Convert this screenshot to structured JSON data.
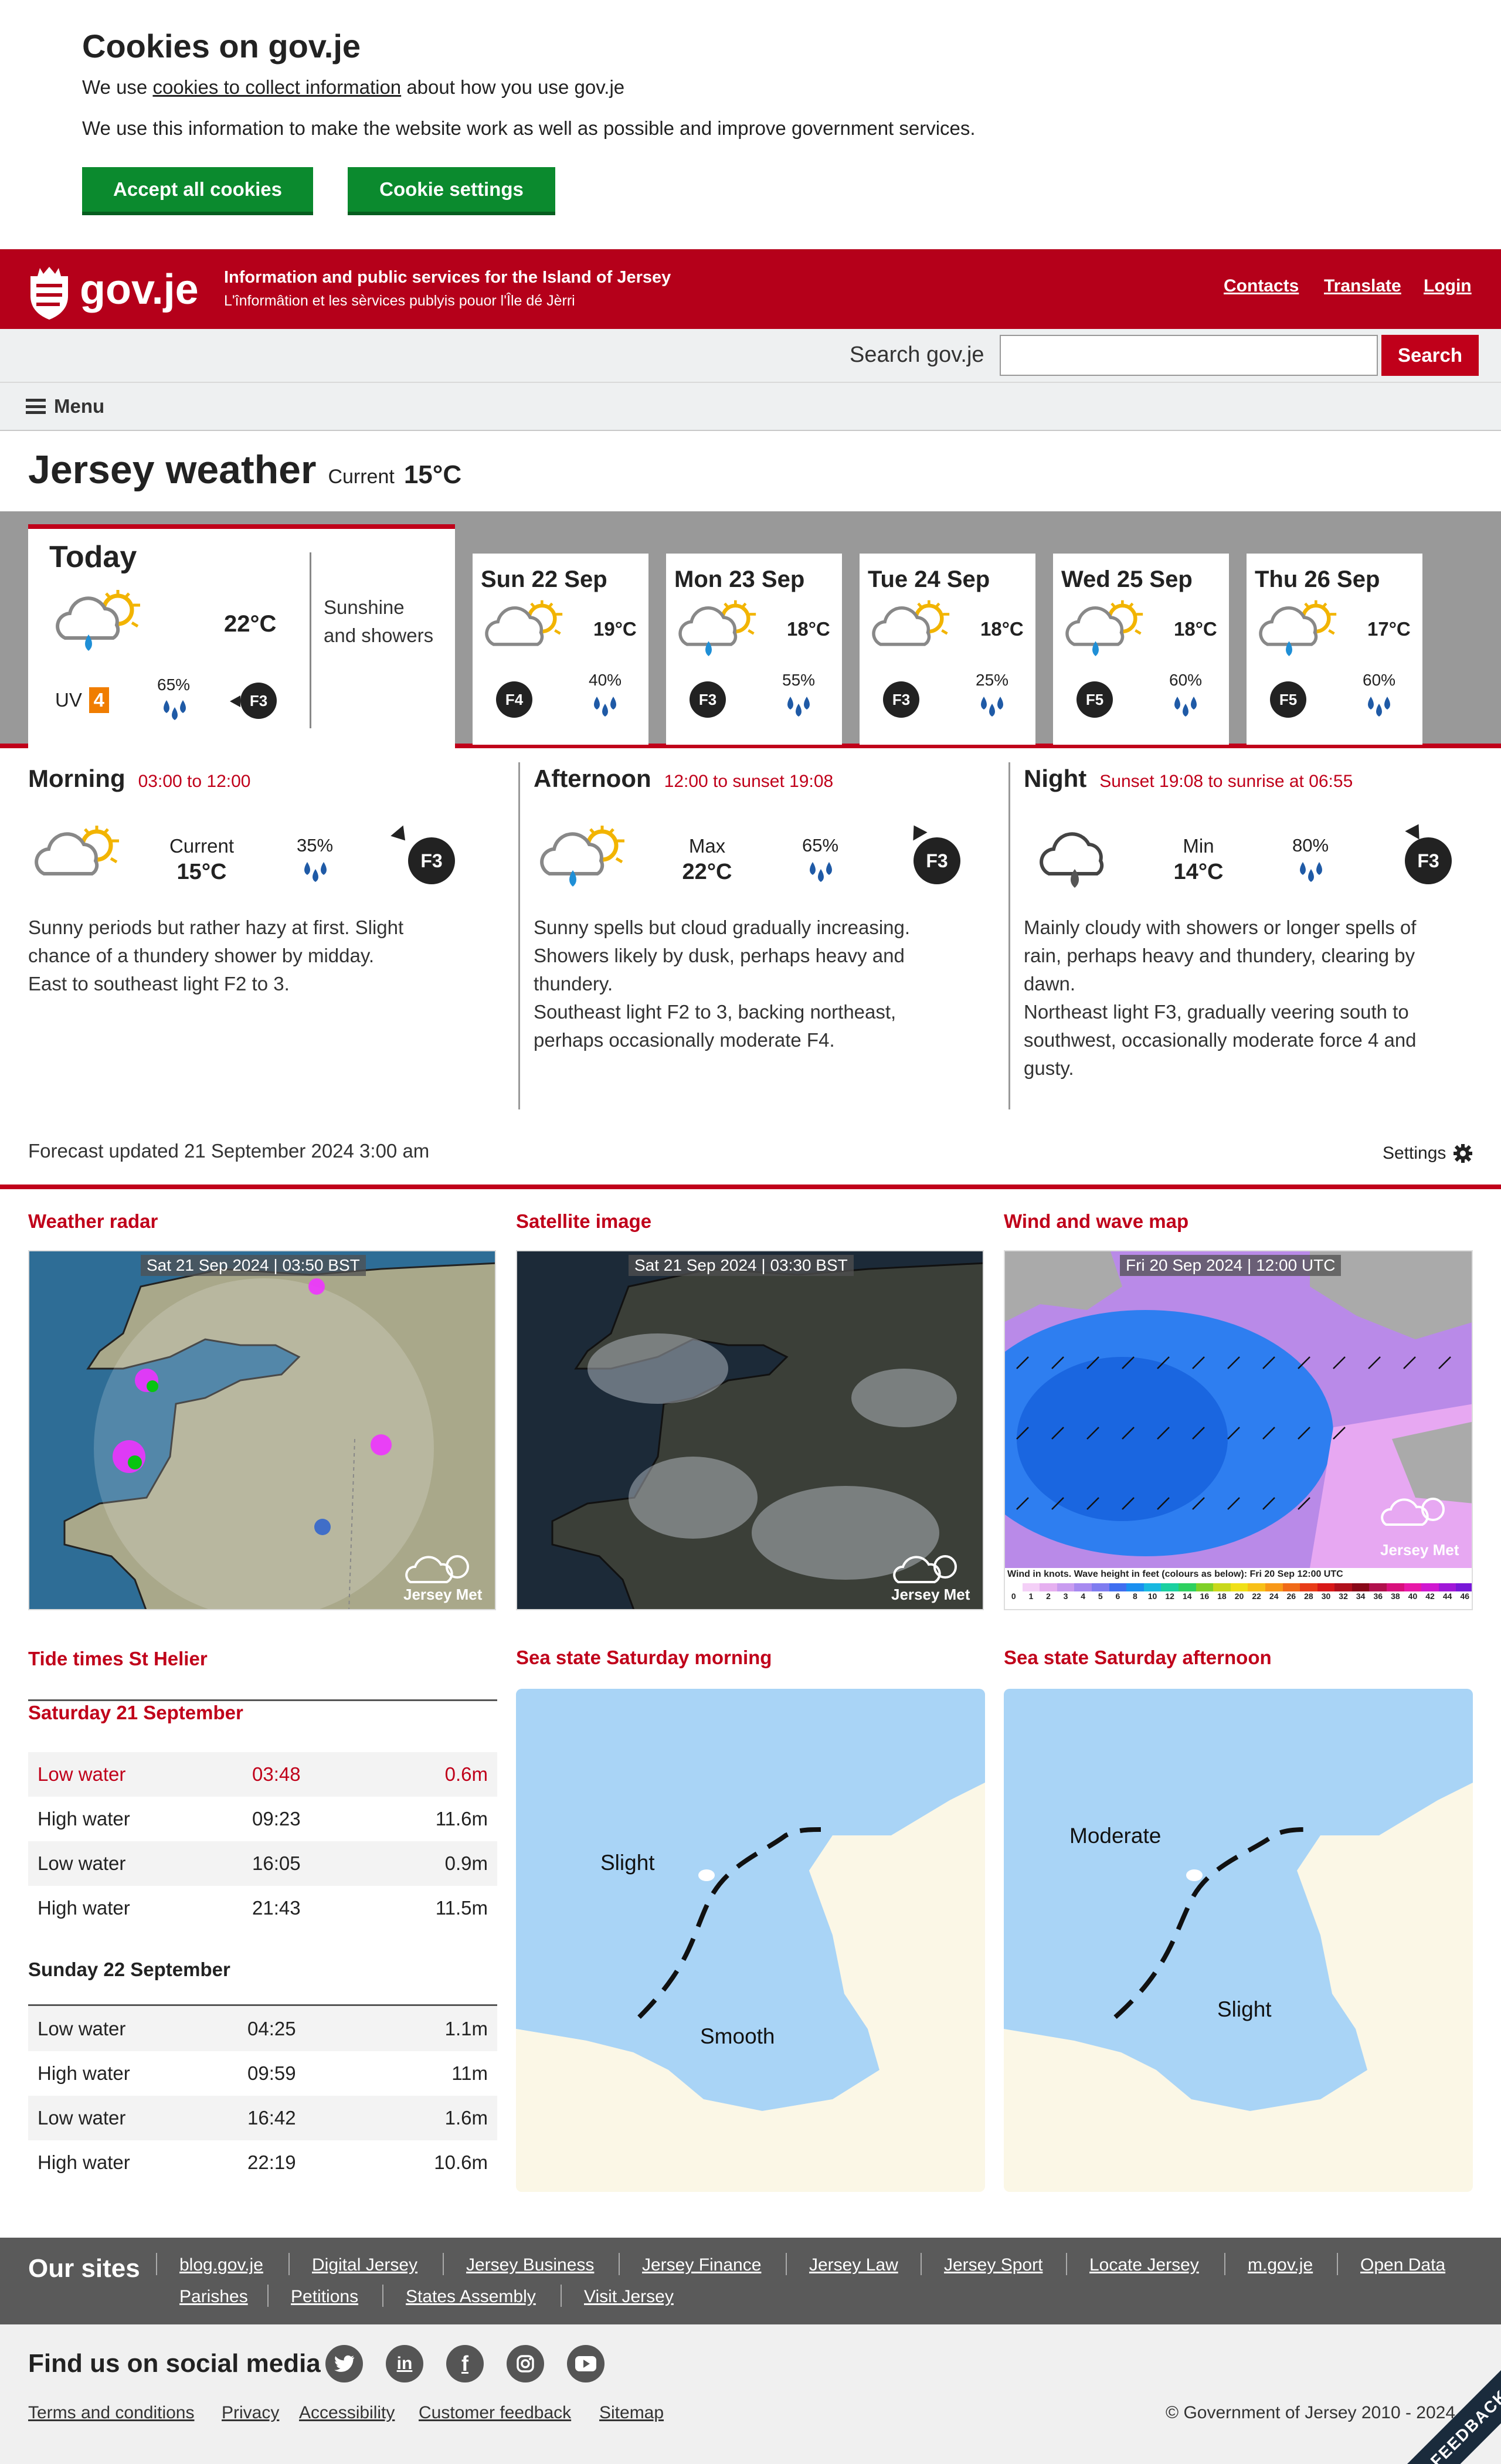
{
  "cookie": {
    "title": "Cookies on gov.je",
    "line1_pre": "We use ",
    "line1_link": "cookies to collect information",
    "line1_post": " about how you use gov.je",
    "line2": "We use this information to make the website work as well as possible and improve government services.",
    "accept_label": "Accept all cookies",
    "settings_label": "Cookie settings"
  },
  "header": {
    "logo_text": "gov.je",
    "tagline_en": "Information and public services for the Island of Jersey",
    "tagline_je": "L'înformâtion et les sèrvices publyis pouor l'Île dé Jèrri",
    "nav": [
      "Contacts",
      "Translate",
      "Login"
    ]
  },
  "search": {
    "label": "Search gov.je",
    "value": "",
    "button": "Search"
  },
  "menu": {
    "label": "Menu"
  },
  "page": {
    "title": "Jersey weather",
    "current_label": "Current",
    "current_temp": "15°C"
  },
  "today": {
    "label": "Today",
    "temp": "22°C",
    "summary_line1": "Sunshine",
    "summary_line2": "and showers",
    "uv_label": "UV",
    "uv_value": "4",
    "rain": "65%",
    "wind": "F3"
  },
  "days": [
    {
      "name": "Sun 22 Sep",
      "temp": "19°C",
      "rain": "40%",
      "wind": "F4"
    },
    {
      "name": "Mon 23 Sep",
      "temp": "18°C",
      "rain": "55%",
      "wind": "F3"
    },
    {
      "name": "Tue 24 Sep",
      "temp": "18°C",
      "rain": "25%",
      "wind": "F3"
    },
    {
      "name": "Wed 25 Sep",
      "temp": "18°C",
      "rain": "60%",
      "wind": "F5"
    },
    {
      "name": "Thu 26 Sep",
      "temp": "17°C",
      "rain": "60%",
      "wind": "F5"
    }
  ],
  "periods": [
    {
      "title": "Morning",
      "time": "03:00 to 12:00",
      "temp_label": "Current",
      "temp": "15°C",
      "rain": "35%",
      "wind": "F3",
      "desc": [
        "Sunny periods but rather hazy at first. Slight",
        "chance of a thundery shower by midday.",
        "East to southeast light F2 to 3."
      ]
    },
    {
      "title": "Afternoon",
      "time": "12:00 to sunset 19:08",
      "temp_label": "Max",
      "temp": "22°C",
      "rain": "65%",
      "wind": "F3",
      "desc": [
        "Sunny spells but cloud gradually increasing.",
        "Showers likely by dusk, perhaps heavy and",
        "thundery.",
        "Southeast light F2 to 3, backing northeast,",
        "perhaps occasionally moderate F4."
      ]
    },
    {
      "title": "Night",
      "time": "Sunset 19:08 to sunrise at 06:55",
      "temp_label": "Min",
      "temp": "14°C",
      "rain": "80%",
      "wind": "F3",
      "desc": [
        "Mainly cloudy with showers or longer spells of",
        "rain, perhaps heavy and thundery, clearing by",
        "dawn.",
        "Northeast light F3, gradually veering south to",
        "southwest, occasionally moderate force 4 and",
        "gusty."
      ]
    }
  ],
  "forecast_updated": "Forecast updated 21 September 2024 3:00 am",
  "settings_label": "Settings",
  "maps": {
    "radar": {
      "title": "Weather radar",
      "stamp": "Sat 21 Sep 2024 | 03:50 BST",
      "brand": "Jersey Met"
    },
    "satellite": {
      "title": "Satellite image",
      "stamp": "Sat 21 Sep 2024 | 03:30 BST",
      "brand": "Jersey Met"
    },
    "wind": {
      "title": "Wind and wave map",
      "stamp": "Fri 20 Sep 2024 | 12:00 UTC",
      "brand": "Jersey Met",
      "legend": "Wind in knots. Wave height in feet (colours as below): Fri 20 Sep 12:00 UTC",
      "scale": [
        "0",
        "1",
        "2",
        "3",
        "4",
        "5",
        "6",
        "8",
        "10",
        "12",
        "14",
        "16",
        "18",
        "20",
        "22",
        "24",
        "26",
        "28",
        "30",
        "32",
        "34",
        "36",
        "38",
        "40",
        "42",
        "44",
        "46"
      ]
    },
    "sea_am": {
      "title": "Sea state Saturday morning",
      "upper": "Slight",
      "lower": "Smooth"
    },
    "sea_pm": {
      "title": "Sea state Saturday afternoon",
      "upper": "Moderate",
      "lower": "Slight"
    }
  },
  "tides": {
    "title": "Tide times St Helier",
    "days": [
      {
        "date": "Saturday 21 September",
        "rows": [
          {
            "type": "Low water",
            "time": "03:48",
            "height": "0.6m"
          },
          {
            "type": "High water",
            "time": "09:23",
            "height": "11.6m"
          },
          {
            "type": "Low water",
            "time": "16:05",
            "height": "0.9m"
          },
          {
            "type": "High water",
            "time": "21:43",
            "height": "11.5m"
          }
        ]
      },
      {
        "date": "Sunday 22 September",
        "rows": [
          {
            "type": "Low water",
            "time": "04:25",
            "height": "1.1m"
          },
          {
            "type": "High water",
            "time": "09:59",
            "height": "11m"
          },
          {
            "type": "Low water",
            "time": "16:42",
            "height": "1.6m"
          },
          {
            "type": "High water",
            "time": "22:19",
            "height": "10.6m"
          }
        ]
      }
    ]
  },
  "our_sites": {
    "title": "Our sites",
    "links": [
      "blog.gov.je",
      "Digital Jersey",
      "Jersey Business",
      "Jersey Finance",
      "Jersey Law",
      "Jersey Sport",
      "Locate Jersey",
      "m.gov.je",
      "Open Data",
      "Parishes",
      "Petitions",
      "States Assembly",
      "Visit Jersey"
    ]
  },
  "social": {
    "title": "Find us on social media",
    "icons": [
      "twitter-icon",
      "linkedin-icon",
      "facebook-icon",
      "instagram-icon",
      "youtube-icon"
    ]
  },
  "footer": {
    "links": [
      "Terms and conditions",
      "Privacy",
      "Accessibility",
      "Customer feedback",
      "Sitemap"
    ],
    "copyright": "© Government of Jersey 2010 - 2024",
    "feedback": "FEEDBACK"
  },
  "colors": {
    "brand_red": "#b5001a",
    "accent_red": "#c0001a",
    "cookie_green": "#0b8a2e"
  }
}
